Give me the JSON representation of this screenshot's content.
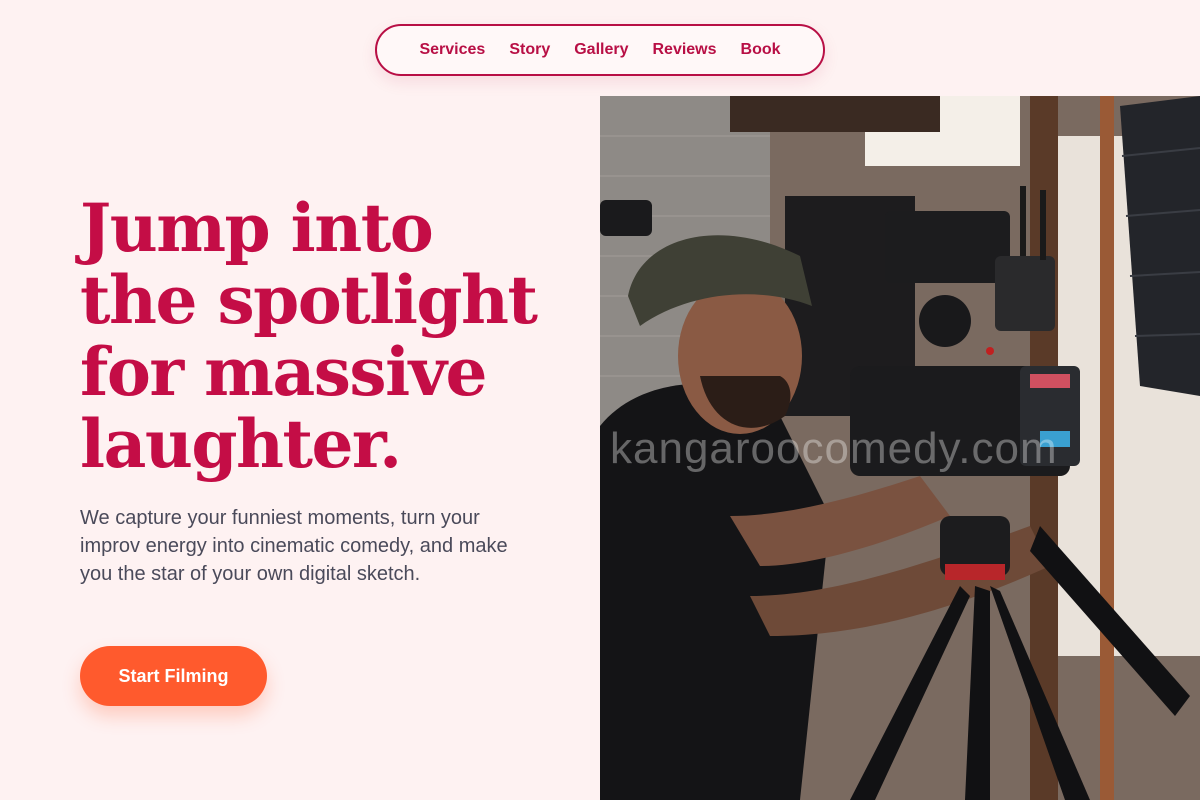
{
  "nav": {
    "items": [
      {
        "label": "Services"
      },
      {
        "label": "Story"
      },
      {
        "label": "Gallery"
      },
      {
        "label": "Reviews"
      },
      {
        "label": "Book"
      }
    ]
  },
  "hero": {
    "title_lines": [
      "Jump into",
      "the spotlight",
      "for massive",
      "laughter."
    ],
    "subtitle": "We capture your funniest moments, turn your improv energy into cinematic comedy, and make you the star of your own digital sketch.",
    "cta_label": "Start Filming"
  },
  "photo": {
    "watermark": "kangaroocomedy.com",
    "subject": "camera-operator-photo"
  },
  "colors": {
    "background": "#fef2f2",
    "accent": "#c40d46",
    "nav_border": "#b80f45",
    "cta": "#ff5a2d",
    "body_text": "#4a4a5a"
  }
}
